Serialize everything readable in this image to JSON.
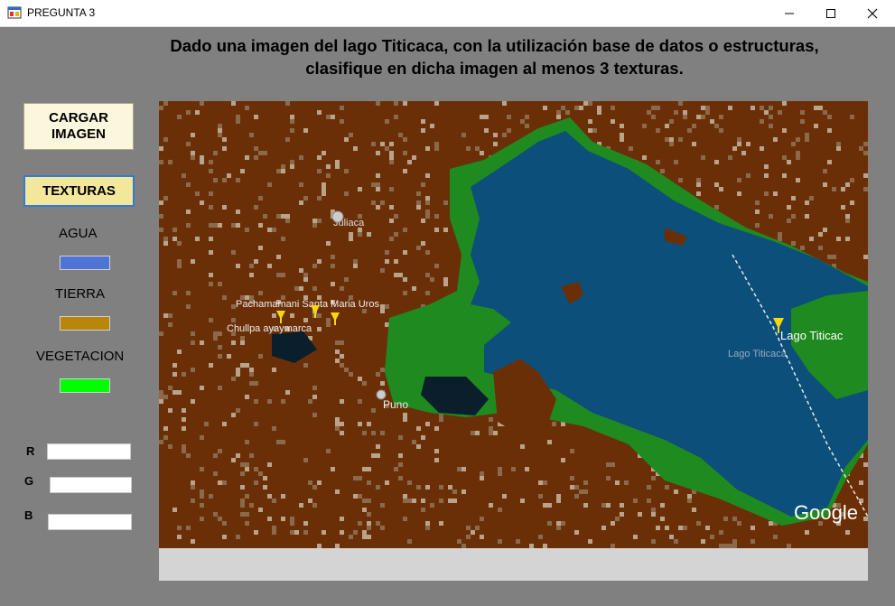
{
  "window": {
    "title": "PREGUNTA 3",
    "controls": [
      "minimize-icon",
      "maximize-icon",
      "close-icon"
    ]
  },
  "heading": {
    "line1": "Dado una imagen del lago Titicaca, con la utilización base de datos o estructuras,",
    "line2": "clasifique en dicha imagen al menos 3 texturas."
  },
  "buttons": {
    "cargar_line1": "CARGAR",
    "cargar_line2": "IMAGEN",
    "texturas": "TEXTURAS"
  },
  "legend": {
    "agua": {
      "label": "AGUA",
      "color": "#4f74d6"
    },
    "tierra": {
      "label": "TIERRA",
      "color": "#b8860b"
    },
    "vegetacion": {
      "label": "VEGETACION",
      "color": "#00ff00"
    }
  },
  "rgb": {
    "r_label": "R",
    "g_label": "G",
    "b_label": "B",
    "r_value": "",
    "g_value": "",
    "b_value": ""
  },
  "map": {
    "lake_name": "Lago Titicaca",
    "lake_label_truncated": "Lago Titicac",
    "lake_sublabel": "Lago Titicaca",
    "city_puno": "Puno",
    "city_north": "Juliaca",
    "place_left": "Pachamamani  Santa Maria  Uros",
    "place_left2": "Chullpa ayaymarca",
    "watermark": "Google",
    "colors": {
      "land": "#6b2f07",
      "water": "#0b4f7a",
      "vegetation": "#1f8a1f",
      "shadow": "#0a1e2b",
      "speckle_light": "#b9a48b",
      "speckle_mid": "#8b6a4c"
    }
  }
}
